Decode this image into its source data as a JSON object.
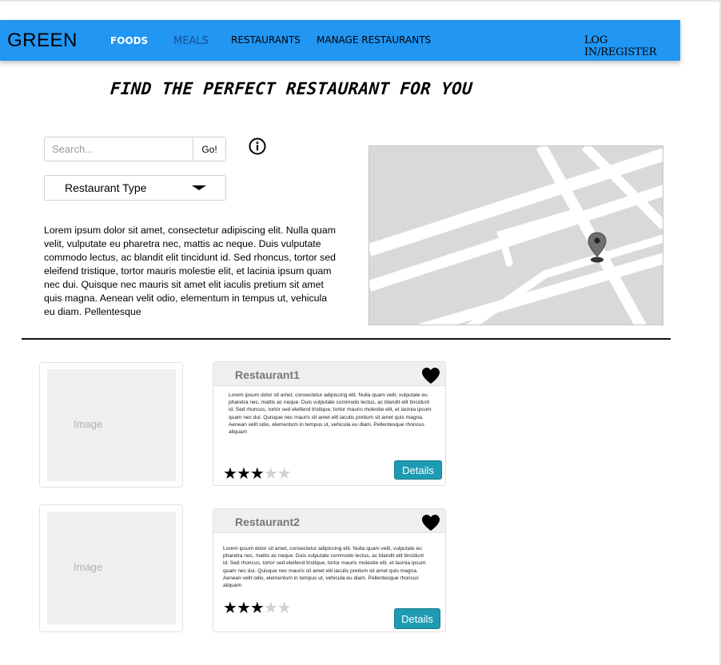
{
  "nav": {
    "brand": "GREEN",
    "links": [
      "FOODS",
      "MEALS",
      "RESTAURANTS",
      "MANAGE RESTAURANTS"
    ],
    "login": "LOG IN/REGISTER"
  },
  "headline": "FIND THE PERFECT RESTAURANT FOR YOU",
  "search": {
    "placeholder": "Search...",
    "value": "",
    "go_label": "Go!"
  },
  "filter": {
    "selected": "Restaurant Type"
  },
  "intro": "Lorem ipsum dolor sit amet, consectetur adipiscing elit. Nulla quam velit, vulputate eu pharetra nec, mattis ac neque. Duis vulputate commodo lectus, ac blandit elit tincidunt id. Sed rhoncus, tortor sed eleifend tristique, tortor mauris molestie elit, et lacinia ipsum quam nec dui. Quisque nec mauris sit amet elit iaculis pretium sit amet quis magna. Aenean velit odio, elementum in tempus ut, vehicula eu diam. Pellentesque",
  "restaurants": [
    {
      "image_label": "Image",
      "name": "Restaurant1",
      "description": "Lorem ipsum dolor sit amet, consectetur adipiscing elit. Nulla quam velit, vulputate eu pharetra nec, mattis ac neque. Duis vulputate commodo lectus, ac blandit elit tincidunt id. Sed rhoncus, tortor sed eleifend tristique, tortor mauris molestie elit, et lacinia ipsum quam nec dui. Quisque nec mauris sit amet elit iaculis pretium sit amet quis magna. Aenean velit odio, elementum in tempus ut, vehicula eu diam. Pellentesque rhoncus aliquam",
      "rating": 3,
      "rating_max": 5,
      "details_label": "Details"
    },
    {
      "image_label": "Image",
      "name": "Restaurant2",
      "description": "Lorem ipsum dolor sit amet, consectetur adipiscing elit. Nulla quam velit, vulputate eu pharetra nec, mattis ac neque. Duis vulputate commodo lectus, ac blandit elit tincidunt id. Sed rhoncus, tortor sed eleifend tristique, tortor mauris molestie elit, et lacinia ipsum quam nec dui. Quisque nec mauris sit amet elit iaculis pretium sit amet quis magna. Aenean velit odio, elementum in tempus ut, vehicula eu diam. Pellentesque rhoncus aliquam",
      "rating": 3,
      "rating_max": 5,
      "details_label": "Details"
    }
  ],
  "icons": [
    "info-icon",
    "chevron-down-icon",
    "map-pin-icon",
    "heart-icon",
    "star-icon"
  ],
  "colors": {
    "nav_bg": "#2196f3",
    "nav_active": "#ffffff",
    "nav_meals": "#1a4d8c",
    "details_button": "#1e9bb3",
    "map_bg": "#d9d9d9"
  }
}
